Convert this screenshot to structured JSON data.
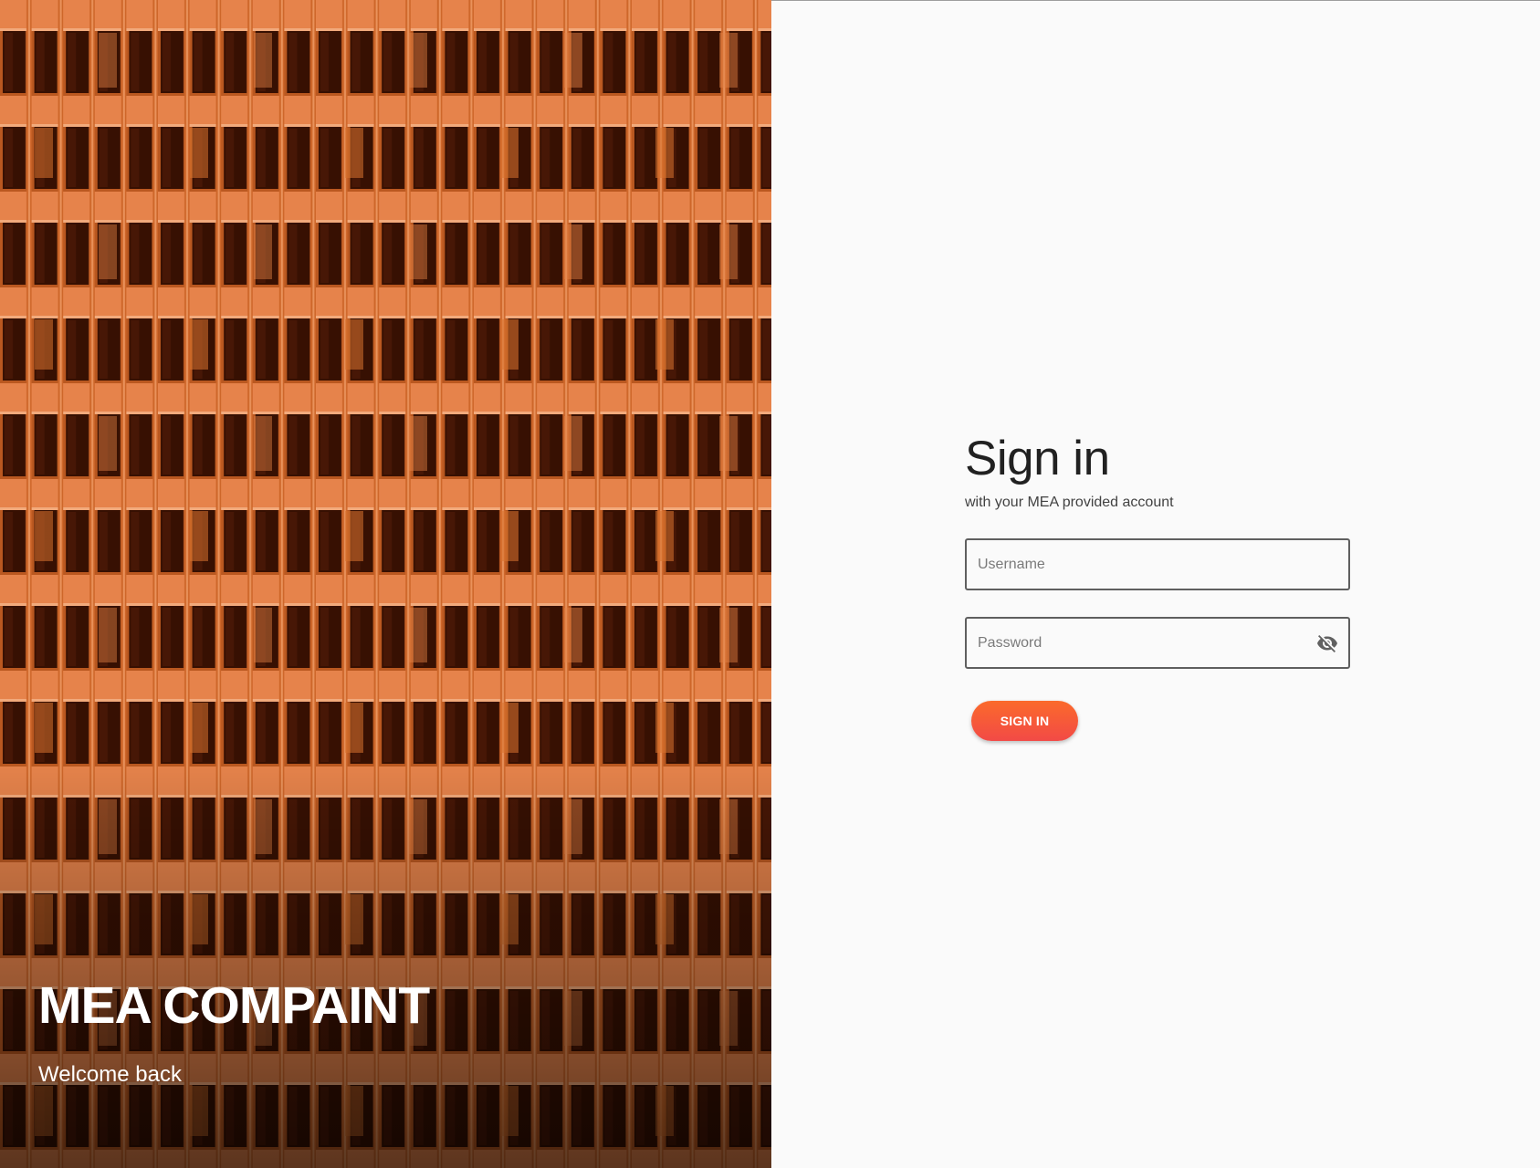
{
  "hero": {
    "title": "MEA COMPAINT",
    "subtitle": "Welcome back",
    "background_image": "orange-tinted office building facade"
  },
  "login": {
    "title": "Sign in",
    "subtitle": "with your MEA provided account",
    "username": {
      "placeholder": "Username",
      "value": ""
    },
    "password": {
      "placeholder": "Password",
      "value": "",
      "toggle_icon": "visibility-off-icon"
    },
    "submit_label": "SIGN IN"
  },
  "colors": {
    "accent_start": "#fb6a2b",
    "accent_end": "#f24a46",
    "hero_tint": "#c25a1a",
    "panel_background": "#fafafa",
    "field_border": "#5f5f5f",
    "text_primary": "#212121"
  }
}
